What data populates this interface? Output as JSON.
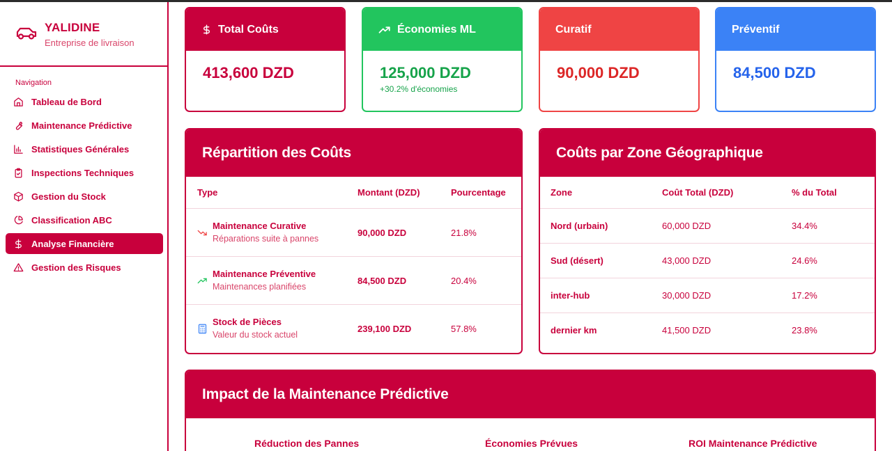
{
  "brand": {
    "name": "YALIDINE",
    "subtitle": "Entreprise de livraison",
    "icon": "truck-icon"
  },
  "nav": {
    "title": "Navigation",
    "items": [
      {
        "label": "Tableau de Bord",
        "icon": "home-icon",
        "active": false
      },
      {
        "label": "Maintenance Prédictive",
        "icon": "wrench-icon",
        "active": false
      },
      {
        "label": "Statistiques Générales",
        "icon": "bar-chart-icon",
        "active": false
      },
      {
        "label": "Inspections Techniques",
        "icon": "clipboard-check-icon",
        "active": false
      },
      {
        "label": "Gestion du Stock",
        "icon": "package-icon",
        "active": false
      },
      {
        "label": "Classification ABC",
        "icon": "pie-chart-icon",
        "active": false
      },
      {
        "label": "Analyse Financière",
        "icon": "dollar-icon",
        "active": true
      },
      {
        "label": "Gestion des Risques",
        "icon": "warning-icon",
        "active": false
      }
    ]
  },
  "kpis": [
    {
      "title": "Total Coûts",
      "value": "413,600 DZD",
      "icon": "dollar-icon",
      "color": "#c8003c"
    },
    {
      "title": "Économies ML",
      "value": "125,000 DZD",
      "note": "+30.2% d'économies",
      "icon": "trending-up-icon",
      "color": "#22c55e"
    },
    {
      "title": "Curatif",
      "value": "90,000 DZD",
      "color": "#ef4444"
    },
    {
      "title": "Préventif",
      "value": "84,500 DZD",
      "color": "#3b82f6"
    }
  ],
  "costs": {
    "title": "Répartition des Coûts",
    "headers": {
      "type": "Type",
      "amount": "Montant (DZD)",
      "percent": "Pourcentage"
    },
    "rows": [
      {
        "title": "Maintenance Curative",
        "subtitle": "Réparations suite à pannes",
        "amount": "90,000 DZD",
        "percent": "21.8%",
        "icon": "trending-down-icon",
        "icon_color": "#ef4444"
      },
      {
        "title": "Maintenance Préventive",
        "subtitle": "Maintenances planifiées",
        "amount": "84,500 DZD",
        "percent": "20.4%",
        "icon": "trending-up-icon",
        "icon_color": "#22c55e"
      },
      {
        "title": "Stock de Pièces",
        "subtitle": "Valeur du stock actuel",
        "amount": "239,100 DZD",
        "percent": "57.8%",
        "icon": "calculator-icon",
        "icon_color": "#3b82f6"
      }
    ]
  },
  "zones": {
    "title": "Coûts par Zone Géographique",
    "headers": {
      "zone": "Zone",
      "cost": "Coût Total (DZD)",
      "share": "% du Total"
    },
    "rows": [
      {
        "zone": "Nord (urbain)",
        "cost": "60,000 DZD",
        "share": "34.4%"
      },
      {
        "zone": "Sud (désert)",
        "cost": "43,000 DZD",
        "share": "24.6%"
      },
      {
        "zone": "inter-hub",
        "cost": "30,000 DZD",
        "share": "17.2%"
      },
      {
        "zone": "dernier km",
        "cost": "41,500 DZD",
        "share": "23.8%"
      }
    ]
  },
  "impact": {
    "title": "Impact de la Maintenance Prédictive",
    "columns": [
      "Réduction des Pannes",
      "Économies Prévues",
      "ROI Maintenance Prédictive"
    ]
  }
}
